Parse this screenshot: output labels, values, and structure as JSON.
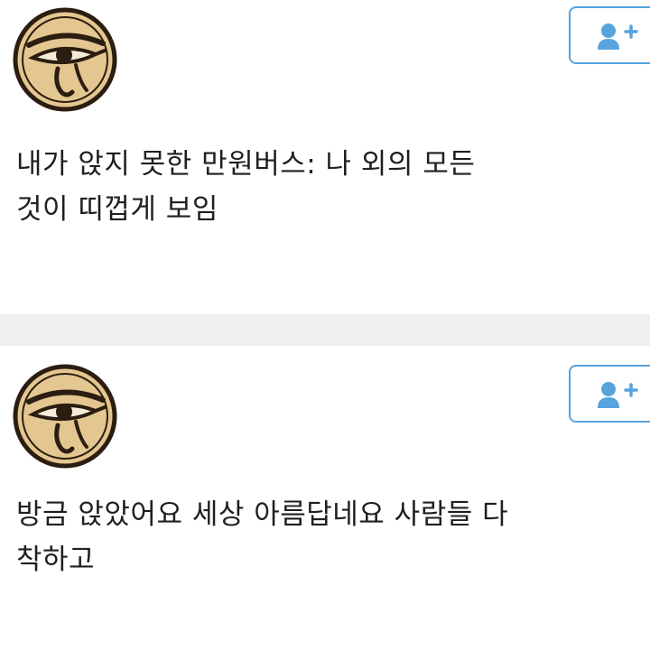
{
  "colors": {
    "accent": "#57a3dc",
    "divider": "#f2eff2",
    "text": "#1f1f1f",
    "avatar_bg": "#e4c690",
    "avatar_ink": "#2b1d10"
  },
  "posts": [
    {
      "avatar_icon": "eye-of-horus-icon",
      "follow_icon": "add-user-icon",
      "text_lines": [
        "내가 앉지 못한 만원버스: 나 외의 모든",
        "것이 띠껍게 보임"
      ]
    },
    {
      "avatar_icon": "eye-of-horus-icon",
      "follow_icon": "add-user-icon",
      "text_lines": [
        "방금 앉았어요 세상 아름답네요 사람들 다",
        "착하고"
      ]
    }
  ]
}
